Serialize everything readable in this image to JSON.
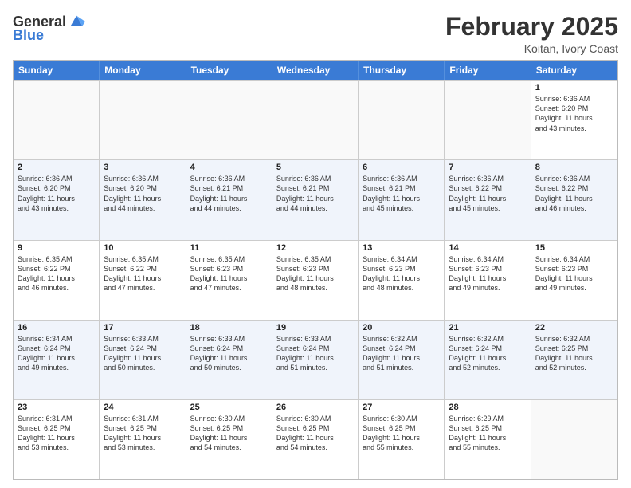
{
  "header": {
    "logo_general": "General",
    "logo_blue": "Blue",
    "month_title": "February 2025",
    "location": "Koitan, Ivory Coast"
  },
  "days_of_week": [
    "Sunday",
    "Monday",
    "Tuesday",
    "Wednesday",
    "Thursday",
    "Friday",
    "Saturday"
  ],
  "weeks": [
    [
      {
        "day": "",
        "info": "",
        "empty": true
      },
      {
        "day": "",
        "info": "",
        "empty": true
      },
      {
        "day": "",
        "info": "",
        "empty": true
      },
      {
        "day": "",
        "info": "",
        "empty": true
      },
      {
        "day": "",
        "info": "",
        "empty": true
      },
      {
        "day": "",
        "info": "",
        "empty": true
      },
      {
        "day": "1",
        "info": "Sunrise: 6:36 AM\nSunset: 6:20 PM\nDaylight: 11 hours\nand 43 minutes."
      }
    ],
    [
      {
        "day": "2",
        "info": "Sunrise: 6:36 AM\nSunset: 6:20 PM\nDaylight: 11 hours\nand 43 minutes."
      },
      {
        "day": "3",
        "info": "Sunrise: 6:36 AM\nSunset: 6:20 PM\nDaylight: 11 hours\nand 44 minutes."
      },
      {
        "day": "4",
        "info": "Sunrise: 6:36 AM\nSunset: 6:21 PM\nDaylight: 11 hours\nand 44 minutes."
      },
      {
        "day": "5",
        "info": "Sunrise: 6:36 AM\nSunset: 6:21 PM\nDaylight: 11 hours\nand 44 minutes."
      },
      {
        "day": "6",
        "info": "Sunrise: 6:36 AM\nSunset: 6:21 PM\nDaylight: 11 hours\nand 45 minutes."
      },
      {
        "day": "7",
        "info": "Sunrise: 6:36 AM\nSunset: 6:22 PM\nDaylight: 11 hours\nand 45 minutes."
      },
      {
        "day": "8",
        "info": "Sunrise: 6:36 AM\nSunset: 6:22 PM\nDaylight: 11 hours\nand 46 minutes."
      }
    ],
    [
      {
        "day": "9",
        "info": "Sunrise: 6:35 AM\nSunset: 6:22 PM\nDaylight: 11 hours\nand 46 minutes."
      },
      {
        "day": "10",
        "info": "Sunrise: 6:35 AM\nSunset: 6:22 PM\nDaylight: 11 hours\nand 47 minutes."
      },
      {
        "day": "11",
        "info": "Sunrise: 6:35 AM\nSunset: 6:23 PM\nDaylight: 11 hours\nand 47 minutes."
      },
      {
        "day": "12",
        "info": "Sunrise: 6:35 AM\nSunset: 6:23 PM\nDaylight: 11 hours\nand 48 minutes."
      },
      {
        "day": "13",
        "info": "Sunrise: 6:34 AM\nSunset: 6:23 PM\nDaylight: 11 hours\nand 48 minutes."
      },
      {
        "day": "14",
        "info": "Sunrise: 6:34 AM\nSunset: 6:23 PM\nDaylight: 11 hours\nand 49 minutes."
      },
      {
        "day": "15",
        "info": "Sunrise: 6:34 AM\nSunset: 6:23 PM\nDaylight: 11 hours\nand 49 minutes."
      }
    ],
    [
      {
        "day": "16",
        "info": "Sunrise: 6:34 AM\nSunset: 6:24 PM\nDaylight: 11 hours\nand 49 minutes."
      },
      {
        "day": "17",
        "info": "Sunrise: 6:33 AM\nSunset: 6:24 PM\nDaylight: 11 hours\nand 50 minutes."
      },
      {
        "day": "18",
        "info": "Sunrise: 6:33 AM\nSunset: 6:24 PM\nDaylight: 11 hours\nand 50 minutes."
      },
      {
        "day": "19",
        "info": "Sunrise: 6:33 AM\nSunset: 6:24 PM\nDaylight: 11 hours\nand 51 minutes."
      },
      {
        "day": "20",
        "info": "Sunrise: 6:32 AM\nSunset: 6:24 PM\nDaylight: 11 hours\nand 51 minutes."
      },
      {
        "day": "21",
        "info": "Sunrise: 6:32 AM\nSunset: 6:24 PM\nDaylight: 11 hours\nand 52 minutes."
      },
      {
        "day": "22",
        "info": "Sunrise: 6:32 AM\nSunset: 6:25 PM\nDaylight: 11 hours\nand 52 minutes."
      }
    ],
    [
      {
        "day": "23",
        "info": "Sunrise: 6:31 AM\nSunset: 6:25 PM\nDaylight: 11 hours\nand 53 minutes."
      },
      {
        "day": "24",
        "info": "Sunrise: 6:31 AM\nSunset: 6:25 PM\nDaylight: 11 hours\nand 53 minutes."
      },
      {
        "day": "25",
        "info": "Sunrise: 6:30 AM\nSunset: 6:25 PM\nDaylight: 11 hours\nand 54 minutes."
      },
      {
        "day": "26",
        "info": "Sunrise: 6:30 AM\nSunset: 6:25 PM\nDaylight: 11 hours\nand 54 minutes."
      },
      {
        "day": "27",
        "info": "Sunrise: 6:30 AM\nSunset: 6:25 PM\nDaylight: 11 hours\nand 55 minutes."
      },
      {
        "day": "28",
        "info": "Sunrise: 6:29 AM\nSunset: 6:25 PM\nDaylight: 11 hours\nand 55 minutes."
      },
      {
        "day": "",
        "info": "",
        "empty": true
      }
    ]
  ]
}
